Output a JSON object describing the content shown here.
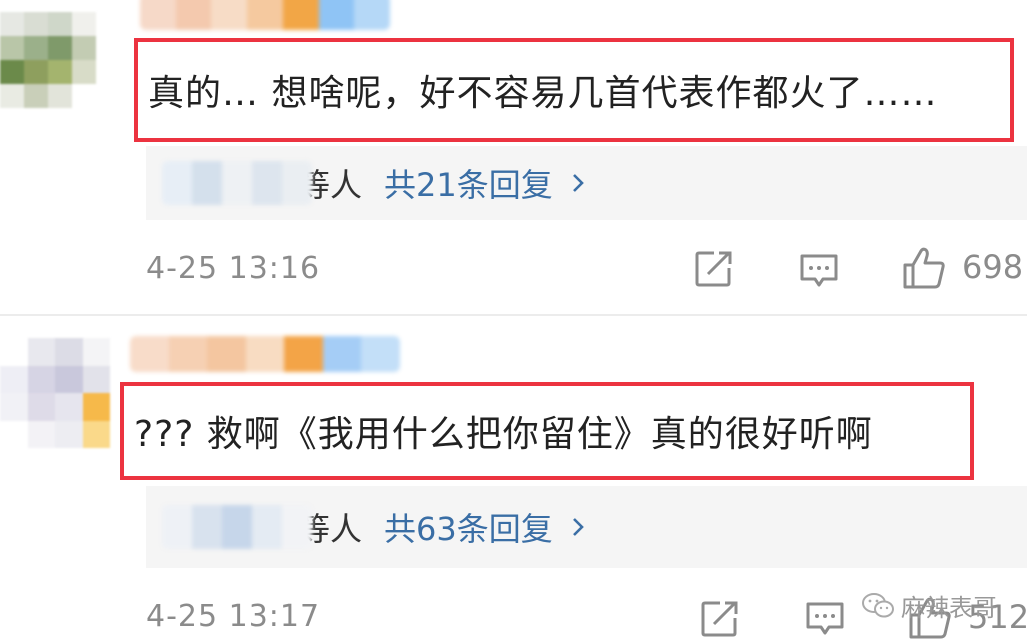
{
  "comments": [
    {
      "text": "真的… 想啥呢，好不容易几首代表作都火了……",
      "reply_suffix": "等人",
      "reply_link": "共21条回复",
      "time": "4-25 13:16",
      "likes": "698"
    },
    {
      "text": "??? 救啊《我用什么把你留住》真的很好听啊",
      "reply_suffix": "等人",
      "reply_link": "共63条回复",
      "time": "4-25 13:17",
      "likes": "512"
    }
  ],
  "watermark": {
    "text": "麻辣表哥"
  },
  "colors": {
    "highlight_border": "#ec3340",
    "link": "#3a6ea5",
    "muted": "#8b8b8b",
    "panel": "#f5f5f5"
  },
  "icons": [
    "share-icon",
    "comment-icon",
    "thumbs-up-icon",
    "wechat-icon",
    "chevron-right-icon"
  ]
}
